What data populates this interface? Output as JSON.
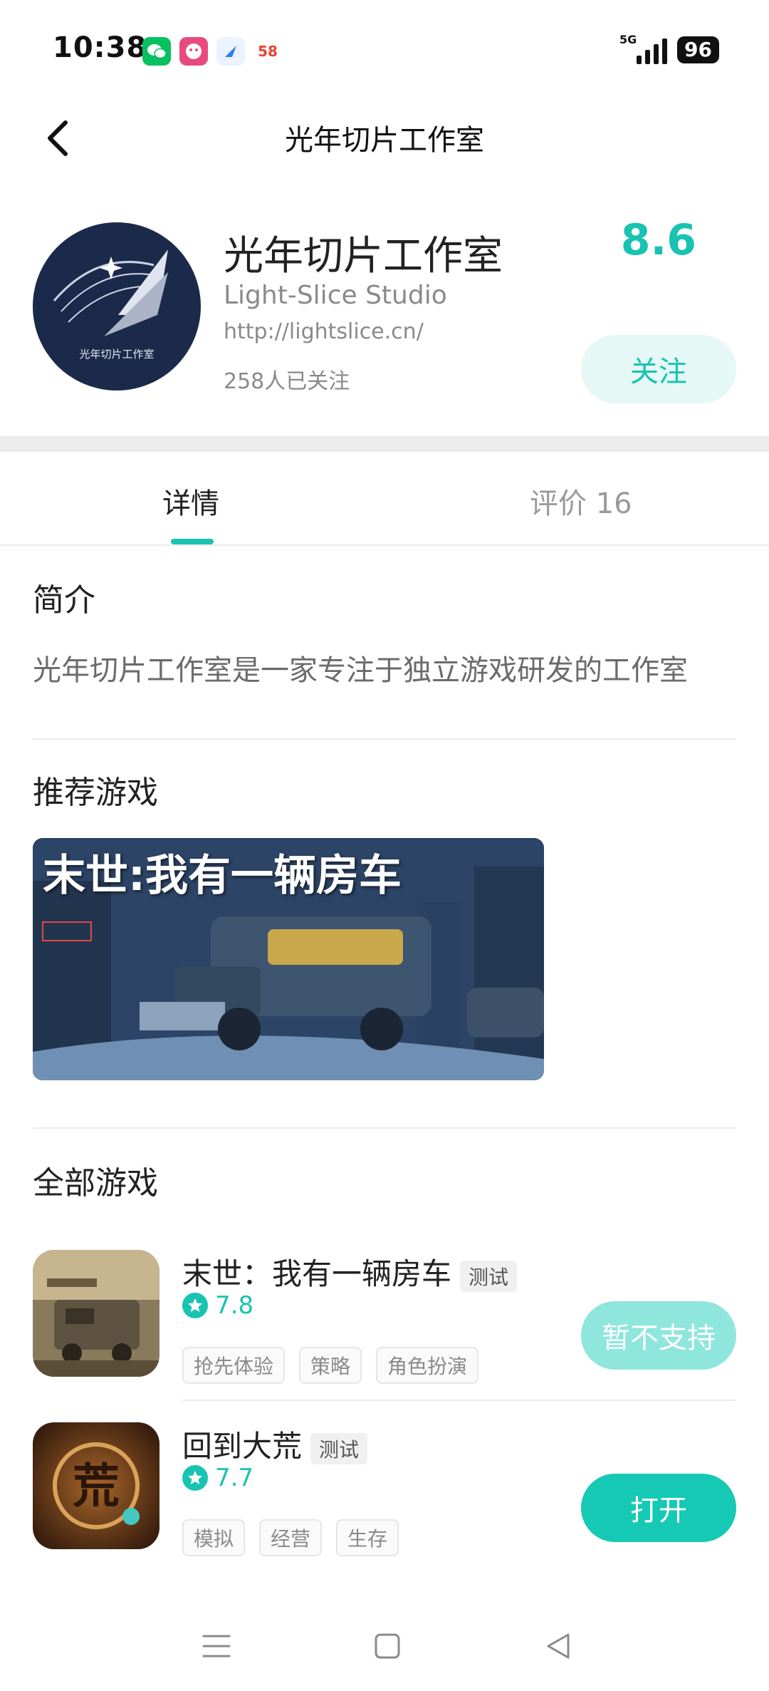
{
  "status_bar": {
    "time": "10:38",
    "network": "5G",
    "battery": "96",
    "notification_icons": [
      "wechat-icon",
      "app-icon",
      "browser-icon",
      "58-icon"
    ],
    "notification_58_label": "58"
  },
  "header": {
    "title": "光年切片工作室",
    "back_icon": "chevron-left-icon"
  },
  "profile": {
    "name": "光年切片工作室",
    "english_name": "Light-Slice Studio",
    "url": "http://lightslice.cn/",
    "followers": "258人已关注",
    "score": "8.6",
    "follow_label": "关注",
    "avatar_caption": "光年切片工作室"
  },
  "tabs": [
    {
      "label": "详情",
      "active": true
    },
    {
      "label": "评价 16",
      "active": false
    }
  ],
  "intro": {
    "title": "简介",
    "text": "光年切片工作室是一家专注于独立游戏研发的工作室"
  },
  "recommended": {
    "title": "推荐游戏",
    "banner_title": "末世:我有一辆房车"
  },
  "all_games": {
    "title": "全部游戏",
    "items": [
      {
        "name": "末世：我有一辆房车",
        "badge": "测试",
        "rating": "7.8",
        "tags": [
          "抢先体验",
          "策略",
          "角色扮演"
        ],
        "action": "暂不支持",
        "action_state": "disabled"
      },
      {
        "name": "回到大荒",
        "badge": "测试",
        "rating": "7.7",
        "tags": [
          "模拟",
          "经营",
          "生存"
        ],
        "action": "打开",
        "action_state": "enabled",
        "icon_glyph": "荒"
      }
    ]
  },
  "colors": {
    "accent": "#19c3b1",
    "accent_light": "#e5f8f6",
    "disabled_button": "#8fe6dc",
    "open_button": "#16c9b4",
    "text_secondary": "#8a8a8a"
  },
  "navbar": [
    "menu-icon",
    "home-square-icon",
    "back-triangle-icon"
  ]
}
